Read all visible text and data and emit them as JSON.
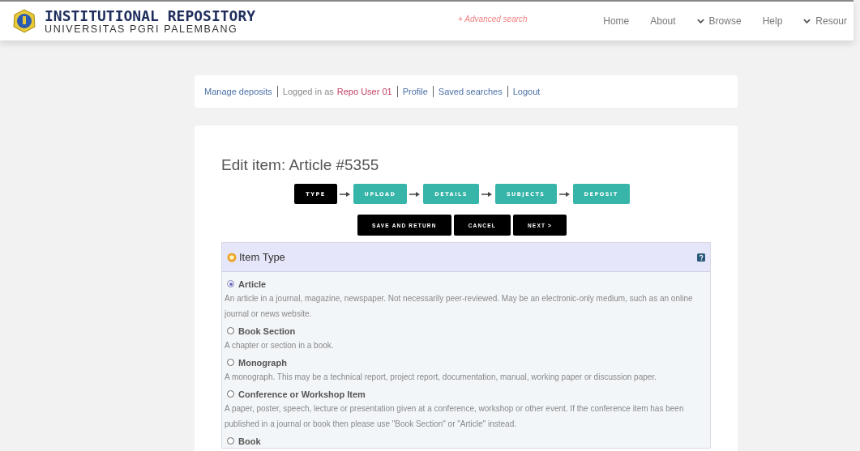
{
  "header": {
    "title": "INSTITUTIONAL REPOSITORY",
    "subtitle": "UNIVERSITAS PGRI PALEMBANG",
    "advanced_search": "+ Advanced search",
    "nav": [
      {
        "label": "Home",
        "dropdown": false
      },
      {
        "label": "About",
        "dropdown": false
      },
      {
        "label": "Browse",
        "dropdown": true
      },
      {
        "label": "Help",
        "dropdown": false
      },
      {
        "label": "Resour",
        "dropdown": true
      }
    ]
  },
  "user_bar": {
    "manage": "Manage deposits",
    "logged_in_as": "Logged in as",
    "user": "Repo User 01",
    "links": [
      "Profile",
      "Saved searches",
      "Logout"
    ]
  },
  "page_title": "Edit item: Article #5355",
  "steps": [
    {
      "label": "TYPE",
      "selected": true
    },
    {
      "label": "UPLOAD",
      "selected": false
    },
    {
      "label": "DETAILS",
      "selected": false
    },
    {
      "label": "SUBJECTS",
      "selected": false
    },
    {
      "label": "DEPOSIT",
      "selected": false
    }
  ],
  "actions": [
    "SAVE AND RETURN",
    "CANCEL",
    "NEXT >"
  ],
  "item_type": {
    "title": "Item Type",
    "options": [
      {
        "label": "Article",
        "selected": true,
        "description": "An article in a journal, magazine, newspaper. Not necessarily peer-reviewed. May be an electronic-only medium, such as an online journal or news website."
      },
      {
        "label": "Book Section",
        "selected": false,
        "description": "A chapter or section in a book."
      },
      {
        "label": "Monograph",
        "selected": false,
        "description": "A monograph. This may be a technical report, project report, documentation, manual, working paper or discussion paper."
      },
      {
        "label": "Conference or Workshop Item",
        "selected": false,
        "description": "A paper, poster, speech, lecture or presentation given at a conference, workshop or other event. If the conference item has been published in a journal or book then please use \"Book Section\" or \"Article\" instead."
      },
      {
        "label": "Book",
        "selected": false
      }
    ]
  }
}
